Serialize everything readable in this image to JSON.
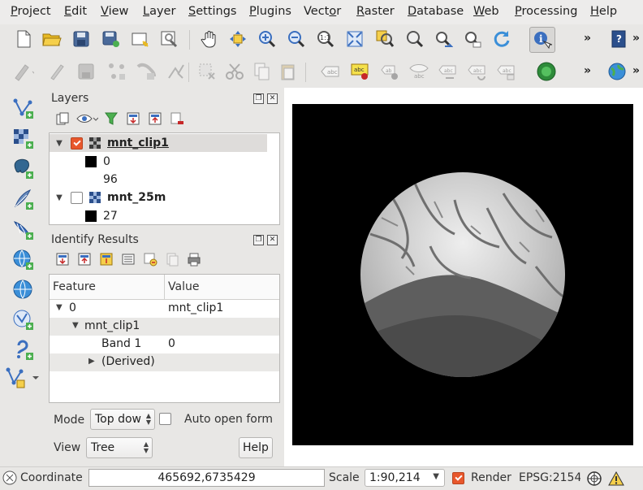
{
  "menu": [
    "Project",
    "Edit",
    "View",
    "Layer",
    "Settings",
    "Plugins",
    "Vector",
    "Raster",
    "Database",
    "Web",
    "Processing",
    "Help"
  ],
  "menu_mnemonic": [
    "P",
    "E",
    "V",
    "L",
    "S",
    "P",
    "o",
    "R",
    "D",
    "W",
    "P",
    "H"
  ],
  "toolbar": {
    "more_label": "»"
  },
  "layers_panel": {
    "title": "Layers",
    "items": [
      {
        "name": "mnt_clip1",
        "checked": true,
        "legend": [
          "0",
          "96"
        ]
      },
      {
        "name": "mnt_25m",
        "checked": false,
        "legend": [
          "27"
        ]
      }
    ]
  },
  "identify_panel": {
    "title": "Identify Results",
    "columns": [
      "Feature",
      "Value"
    ],
    "rows": [
      {
        "feature": "0",
        "value": "mnt_clip1"
      },
      {
        "feature": "mnt_clip1",
        "value": ""
      },
      {
        "feature": "Band 1",
        "value": "0"
      },
      {
        "feature": "(Derived)",
        "value": ""
      }
    ],
    "mode_label": "Mode",
    "mode_value": "Top dow",
    "auto_open_label": "Auto open form",
    "view_label": "View",
    "view_value": "Tree",
    "help_label": "Help"
  },
  "status": {
    "coord_label": "Coordinate",
    "coord_value": "465692,6735429",
    "scale_label": "Scale",
    "scale_value": "1:90,214",
    "render_label": "Render",
    "crs_text": "EPSG:2154"
  },
  "colors": {
    "accent": "#e8572c",
    "map_bg": "#000000"
  }
}
